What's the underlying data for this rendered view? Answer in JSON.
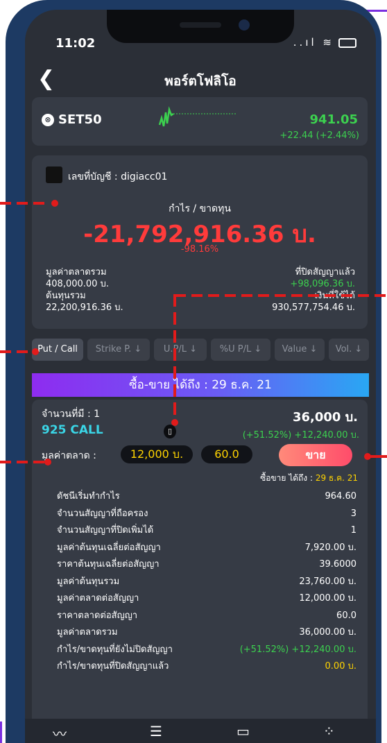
{
  "status_bar": {
    "time": "11:02",
    "icons": "..ıl ≋"
  },
  "header": {
    "back_icon": "chevron-left-icon",
    "title": "พอร์ตโฟลิโอ"
  },
  "index": {
    "name": "SET50",
    "value": "941.05",
    "change": "+22.44 (+2.44%)"
  },
  "account": {
    "label": "เลขที่บัญชี : digiacc01",
    "pl_title": "กำไร / ขาดทุน",
    "pl_value": "-21,792,916.36 บ.",
    "pl_pct": "-98.16%",
    "market_value_label": "มูลค่าตลาดรวม",
    "market_value": "408,000.00 บ.",
    "closed_label": "ที่ปิดสัญญาแล้ว",
    "closed_value": "+98,096.36 บ.",
    "cost_label": "ต้นทุนรวม",
    "cost_value": "22,200,916.36 บ.",
    "cash_label": "เงินที่ใช้ได้",
    "cash_value": "930,577,754.46 บ."
  },
  "tabs": [
    "Put / Call",
    "Strike P. ↓",
    "U.P/L ↓",
    "%U P/L ↓",
    "Value ↓",
    "Vol. ↓"
  ],
  "banner": "ซื้อ-ขาย ได้ถึง : 29 ธ.ค. 21",
  "position": {
    "qty_label": "จำนวนที่มี : 1",
    "amount": "36,000 บ.",
    "symbol": "925 CALL",
    "pl": "(+51.52%) +12,240.00 บ.",
    "mv_label": "มูลค่าตลาด :",
    "mv_value": "12,000 บ.",
    "price": "60.0",
    "sell_label": "ขาย",
    "deadline_label": "ซื้อขาย ได้ถึง :",
    "deadline_date": "29 ธ.ค. 21",
    "rows": [
      {
        "label": "ดัชนีเริ่มทำกำไร",
        "value": "964.60"
      },
      {
        "label": "จำนวนสัญญาที่ถือครอง",
        "value": "3"
      },
      {
        "label": "จำนวนสัญญาที่ปิดเพิ่มได้",
        "value": "1"
      },
      {
        "label": "มูลค่าต้นทุนเฉลี่ยต่อสัญญา",
        "value": "7,920.00 บ."
      },
      {
        "label": "ราคาต้นทุนเฉลี่ยต่อสัญญา",
        "value": "39.6000"
      },
      {
        "label": "มูลค่าต้นทุนรวม",
        "value": "23,760.00 บ."
      },
      {
        "label": "มูลค่าตลาดต่อสัญญา",
        "value": "12,000.00 บ."
      },
      {
        "label": "ราคาตลาดต่อสัญญา",
        "value": "60.0"
      },
      {
        "label": "มูลค่าตลาดรวม",
        "value": "36,000.00 บ."
      },
      {
        "label": "กำไร/ขาดทุนที่ยังไม่ปิดสัญญา",
        "value": "(+51.52%) +12,240.00 บ."
      },
      {
        "label": "กำไร/ขาดทุนที่ปิดสัญญาแล้ว",
        "value": "0.00 บ."
      }
    ]
  },
  "nav": [
    "chart-icon",
    "menu-icon",
    "folder-icon",
    "dots-icon"
  ],
  "colors": {
    "accent": "#7b2fe0",
    "positive": "#3cd14f",
    "negative": "#ff3b3b",
    "highlight": "#ffd400",
    "symbol": "#3ad5e6"
  }
}
